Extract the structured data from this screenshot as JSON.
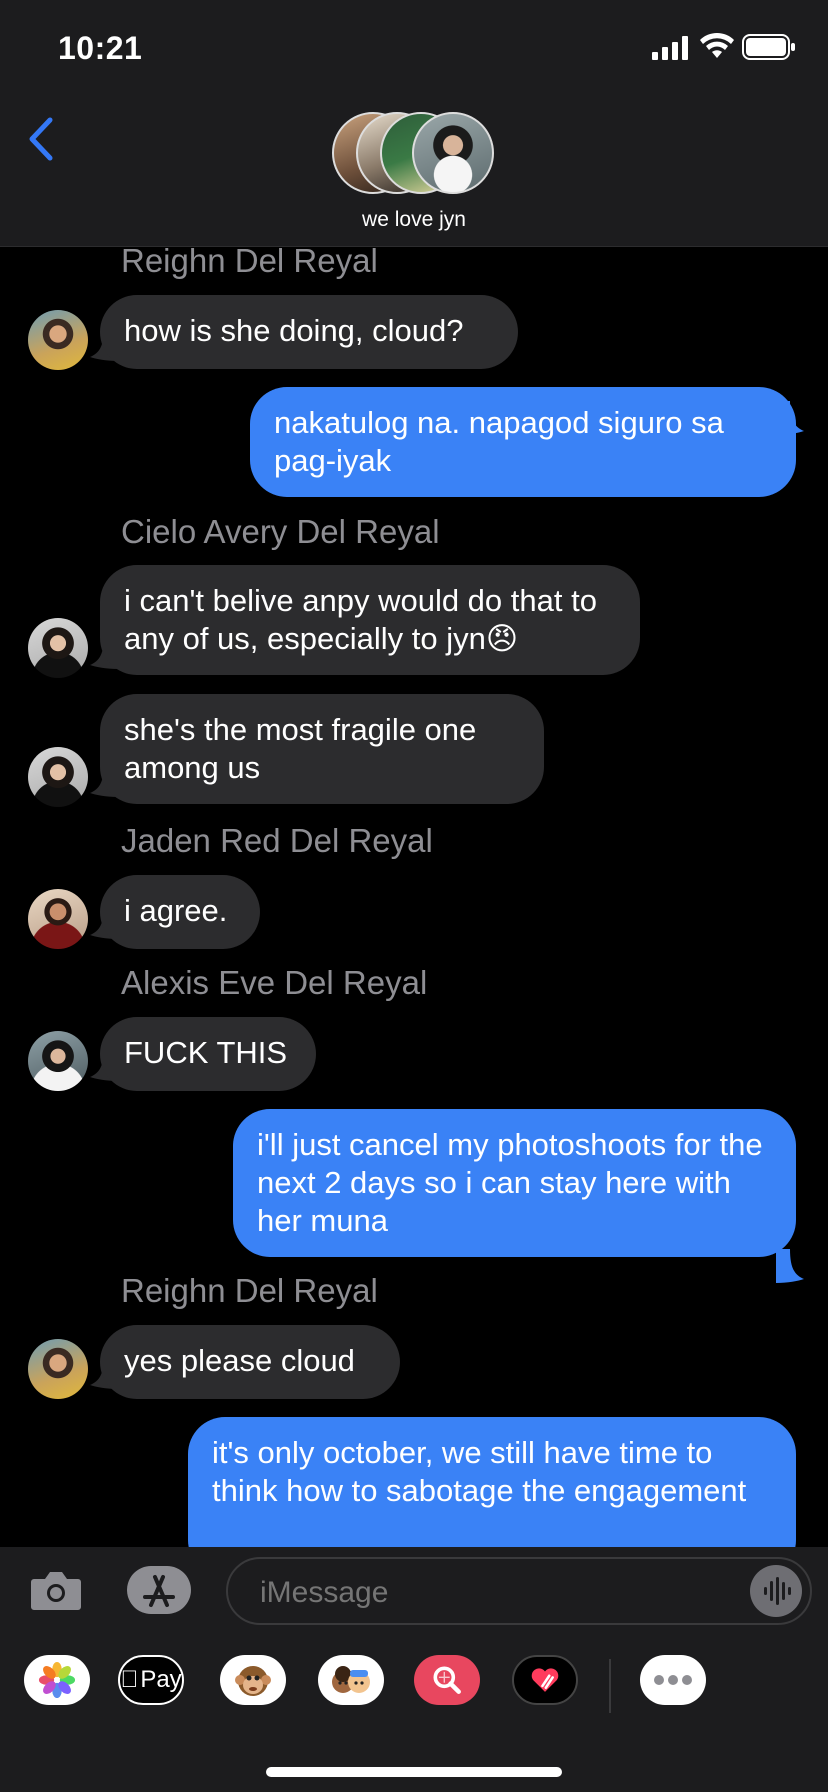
{
  "status": {
    "time": "10:21"
  },
  "header": {
    "group_name": "we love jyn"
  },
  "messages": [
    {
      "sender": "Reighn Del Reyal",
      "text": "how is she doing, cloud?"
    },
    {
      "sender": "me",
      "text": "nakatulog na. napagod siguro sa pag-iyak"
    },
    {
      "sender": "Cielo Avery Del Reyal",
      "text": "i can't belive anpy would do that to any of us, especially to jyn😠"
    },
    {
      "sender": "Cielo Avery Del Reyal",
      "text": "she's the most fragile one among us"
    },
    {
      "sender": "Jaden Red Del Reyal",
      "text": "i agree."
    },
    {
      "sender": "Alexis Eve Del Reyal",
      "text": "FUCK THIS"
    },
    {
      "sender": "me",
      "text": "i'll just cancel my photoshoots for the next 2 days so i can stay here with her muna"
    },
    {
      "sender": "Reighn Del Reyal",
      "text": "yes please cloud"
    },
    {
      "sender": "me",
      "text": "it's only october, we still have time to think how to sabotage the engagement"
    }
  ],
  "composer": {
    "placeholder": "iMessage",
    "apps": [
      "photos-icon",
      "apple-pay-icon",
      "animoji-icon",
      "memoji-stickers-icon",
      "image-search-icon",
      "digital-touch-icon",
      "more-apps-icon"
    ],
    "apple_pay_label": "Pay"
  },
  "colors": {
    "outgoing": "#3a82f6",
    "incoming": "#2c2c2e",
    "bar": "#1c1c1e",
    "accent": "#3478f6"
  }
}
